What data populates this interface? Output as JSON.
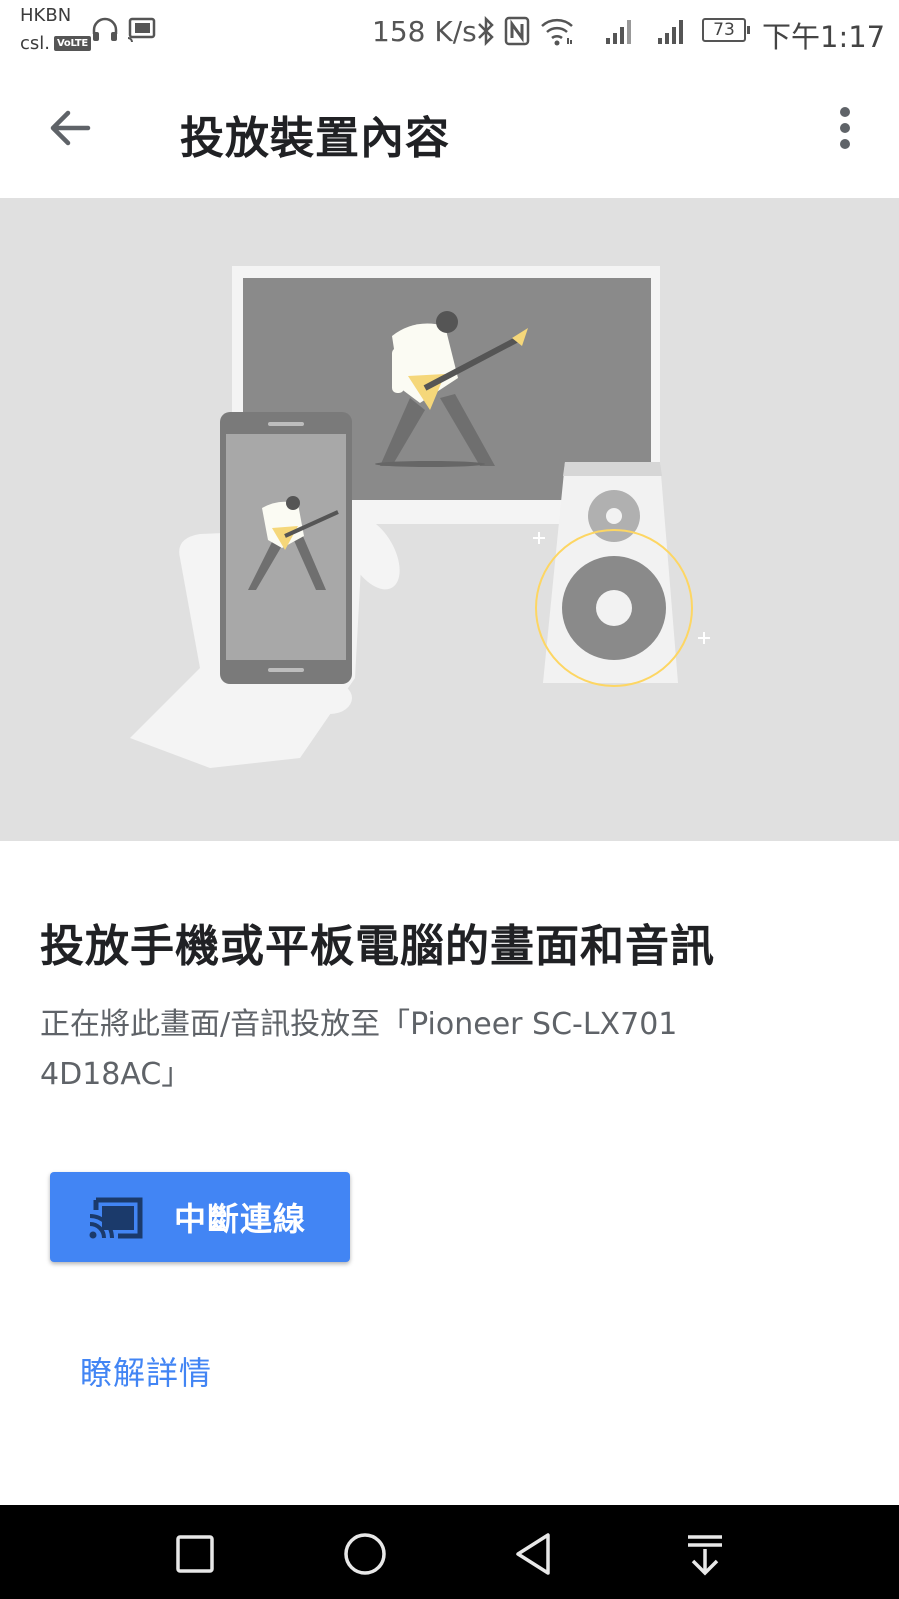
{
  "status_bar": {
    "carrier_top": "HKBN",
    "carrier_bottom": "csl.",
    "volte": "VoLTE",
    "net_speed": "158 K/s",
    "battery": "73",
    "time": "下午1:17"
  },
  "app_bar": {
    "title": "投放裝置內容"
  },
  "content": {
    "headline": "投放手機或平板電腦的畫面和音訊",
    "subtext": "正在將此畫面/音訊投放至「Pioneer SC-LX701 4D18AC」",
    "disconnect_label": "中斷連線",
    "learn_more": "瞭解詳情"
  },
  "colors": {
    "accent": "#4285f4",
    "hero_bg": "#e0e0e0",
    "highlight": "#fdd663"
  }
}
